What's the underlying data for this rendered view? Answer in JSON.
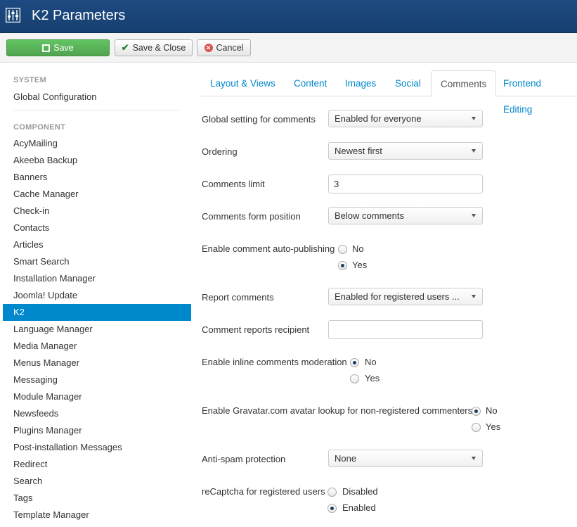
{
  "header": {
    "title": "K2 Parameters",
    "icon": "settings-sliders-icon"
  },
  "toolbar": {
    "save_label": "Save",
    "save_close_label": "Save & Close",
    "cancel_label": "Cancel"
  },
  "sidebar": {
    "system_heading": "SYSTEM",
    "global_config": "Global Configuration",
    "component_heading": "COMPONENT",
    "items": [
      {
        "label": "AcyMailing"
      },
      {
        "label": "Akeeba Backup"
      },
      {
        "label": "Banners"
      },
      {
        "label": "Cache Manager"
      },
      {
        "label": "Check-in"
      },
      {
        "label": "Contacts"
      },
      {
        "label": "Articles"
      },
      {
        "label": "Smart Search"
      },
      {
        "label": "Installation Manager"
      },
      {
        "label": "Joomla! Update"
      },
      {
        "label": "K2"
      },
      {
        "label": "Language Manager"
      },
      {
        "label": "Media Manager"
      },
      {
        "label": "Menus Manager"
      },
      {
        "label": "Messaging"
      },
      {
        "label": "Module Manager"
      },
      {
        "label": "Newsfeeds"
      },
      {
        "label": "Plugins Manager"
      },
      {
        "label": "Post-installation Messages"
      },
      {
        "label": "Redirect"
      },
      {
        "label": "Search"
      },
      {
        "label": "Tags"
      },
      {
        "label": "Template Manager"
      }
    ],
    "active_item": "K2"
  },
  "tabs": [
    {
      "label": "Layout & Views"
    },
    {
      "label": "Content"
    },
    {
      "label": "Images"
    },
    {
      "label": "Social"
    },
    {
      "label": "Comments"
    },
    {
      "label": "Frontend Editing"
    }
  ],
  "active_tab": "Comments",
  "form": {
    "global_comments": {
      "label": "Global setting for comments",
      "value": "Enabled for everyone"
    },
    "ordering": {
      "label": "Ordering",
      "value": "Newest first"
    },
    "comments_limit": {
      "label": "Comments limit",
      "value": "3"
    },
    "form_position": {
      "label": "Comments form position",
      "value": "Below comments"
    },
    "auto_publish": {
      "label": "Enable comment auto-publishing",
      "options": [
        "No",
        "Yes"
      ],
      "selected": "Yes"
    },
    "report_comments": {
      "label": "Report comments",
      "value": "Enabled for registered users ..."
    },
    "report_recipient": {
      "label": "Comment reports recipient",
      "value": ""
    },
    "inline_moderation": {
      "label": "Enable inline comments moderation",
      "options": [
        "No",
        "Yes"
      ],
      "selected": "No"
    },
    "gravatar": {
      "label": "Enable Gravatar.com avatar lookup for non-registered commenters",
      "options": [
        "No",
        "Yes"
      ],
      "selected": "No"
    },
    "antispam": {
      "label": "Anti-spam protection",
      "value": "None"
    },
    "recaptcha": {
      "label": "reCaptcha for registered users",
      "options": [
        "Disabled",
        "Enabled"
      ],
      "selected": "Enabled"
    }
  }
}
